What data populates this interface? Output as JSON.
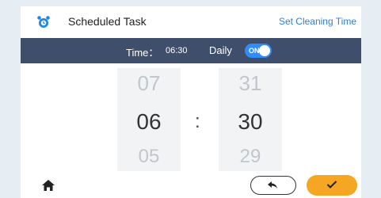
{
  "header": {
    "title": "Scheduled Task",
    "link": "Set Cleaning Time",
    "icon": "alarm-clock-icon"
  },
  "status": {
    "time_label": "Time：",
    "time_value": "06:30",
    "daily_label": "Daily",
    "toggle_text": "ON",
    "toggle_color": "#2f8cff"
  },
  "picker": {
    "hours": {
      "prev": "07",
      "selected": "06",
      "next": "05"
    },
    "minutes": {
      "prev": "31",
      "selected": "30",
      "next": "29"
    },
    "separator": ":"
  },
  "footer": {
    "home_icon": "home-icon",
    "back_icon": "undo-arrow-icon",
    "confirm_icon": "checkmark-icon",
    "confirm_color": "#f5a623"
  },
  "colors": {
    "accent": "#2f7fd8",
    "bar": "#3f4e6b",
    "background": "#e6eef4"
  }
}
